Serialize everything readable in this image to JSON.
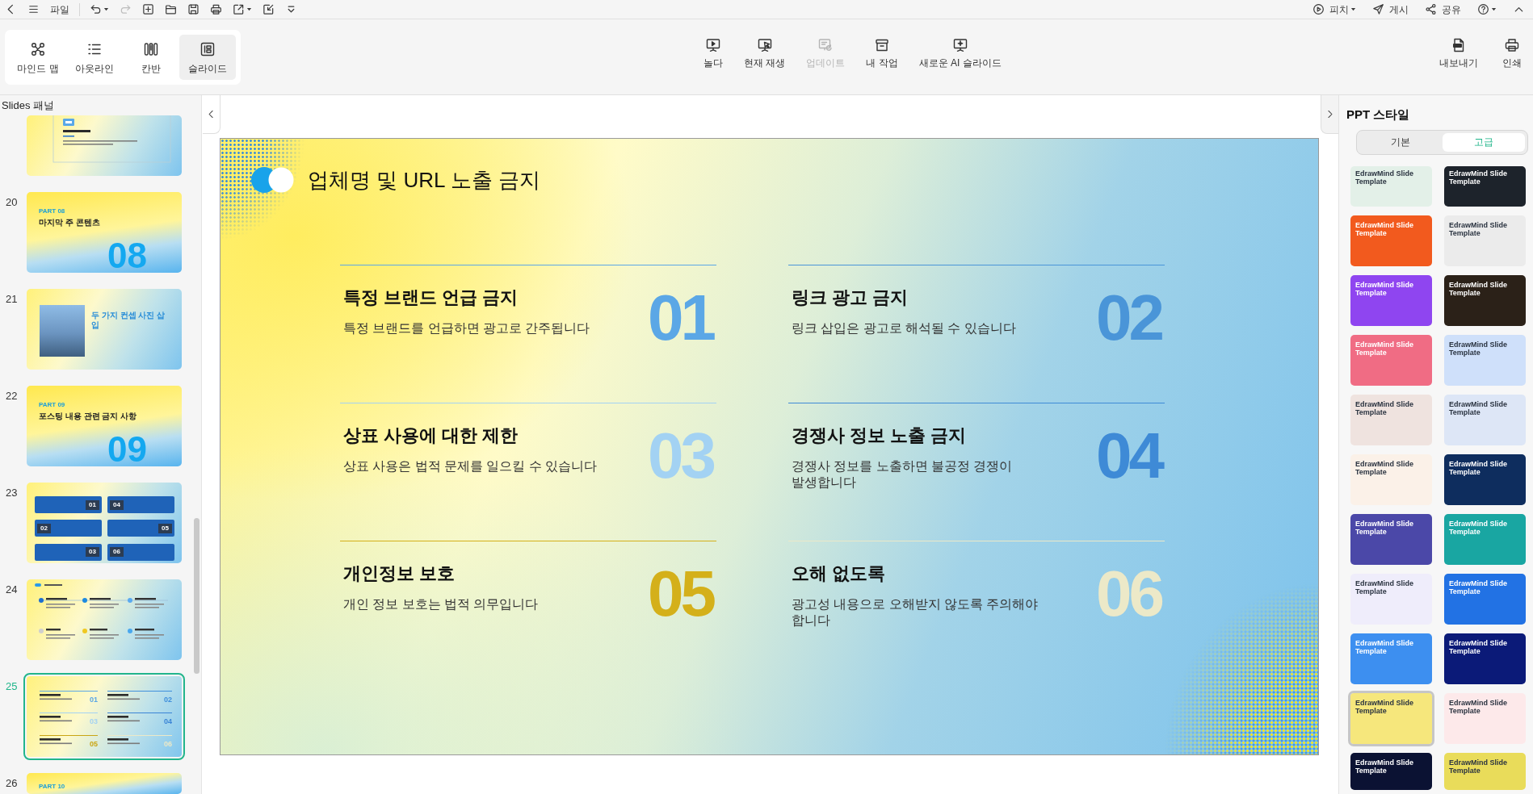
{
  "top_bar": {
    "file_menu": "파일",
    "undo": {
      "disabled": false
    },
    "redo": {
      "disabled": true
    },
    "actions": [
      {
        "label": "피치",
        "dropdown": true
      },
      {
        "label": "게시",
        "dropdown": false
      },
      {
        "label": "공유",
        "dropdown": false
      }
    ]
  },
  "ribbon": {
    "views": [
      {
        "label": "마인드 맵",
        "selected": false
      },
      {
        "label": "아웃라인",
        "selected": false
      },
      {
        "label": "칸반",
        "selected": false
      },
      {
        "label": "슬라이드",
        "selected": true
      }
    ],
    "actions": [
      {
        "label": "놀다",
        "disabled": false
      },
      {
        "label": "현재 재생",
        "disabled": false
      },
      {
        "label": "업데이트",
        "disabled": true
      },
      {
        "label": "내 작업",
        "disabled": false
      },
      {
        "label": "새로운 AI 슬라이드",
        "disabled": false
      }
    ],
    "outputs": [
      "내보내기",
      "인쇄"
    ]
  },
  "slides_panel": {
    "title": "Slides 패널",
    "slides": [
      {
        "kind": "text",
        "selected": false
      },
      {
        "number": "20",
        "kind": "section",
        "part": "PART 08",
        "title": "마지막 주 콘텐츠",
        "big_number": "08",
        "selected": false
      },
      {
        "number": "21",
        "kind": "photo",
        "title": "두 가지 컨셉 사진 삽입",
        "selected": false
      },
      {
        "number": "22",
        "kind": "section",
        "part": "PART 09",
        "title": "포스팅 내용 관련 금지 사항",
        "big_number": "09",
        "selected": false
      },
      {
        "number": "23",
        "kind": "grid",
        "numbers": [
          "01",
          "04",
          "02",
          "05",
          "03",
          "06"
        ],
        "selected": false
      },
      {
        "number": "24",
        "kind": "timeline",
        "selected": false
      },
      {
        "number": "25",
        "kind": "list",
        "numbers": [
          {
            "text": "01",
            "color": "#5ba7e6"
          },
          {
            "text": "02",
            "color": "#3f8fdc"
          },
          {
            "text": "03",
            "color": "#a3d2f3"
          },
          {
            "text": "04",
            "color": "#3a84d6"
          },
          {
            "text": "05",
            "color": "#c9a514"
          },
          {
            "text": "06",
            "color": "#ece9c8"
          }
        ],
        "selected": true
      },
      {
        "number": "26",
        "kind": "section",
        "part": "PART 10",
        "selected": false
      }
    ]
  },
  "slide": {
    "title": "업체명 및 URL 노출 금지",
    "items": [
      {
        "title": "특정 브랜드 언급 금지",
        "description": "특정 브랜드를 언급하면 광고로 간주됩니다",
        "number": "01",
        "color": "#5ba7e6"
      },
      {
        "title": "링크 광고 금지",
        "description": "링크 삽입은 광고로 해석될 수 있습니다",
        "number": "02",
        "color": "#4a95d8"
      },
      {
        "title": "상표 사용에 대한 제한",
        "description": "상표 사용은 법적 문제를 일으킬 수 있습니다",
        "number": "03",
        "color": "#a3d2f3"
      },
      {
        "title": "경쟁사 정보 노출 금지",
        "description": "경쟁사 정보를 노출하면 불공정 경쟁이 발생합니다",
        "number": "04",
        "color": "#3e8ad6"
      },
      {
        "title": "개인정보 보호",
        "description": "개인 정보 보호는 법적 의무입니다",
        "number": "05",
        "color": "#d4b01a"
      },
      {
        "title": "오해 없도록",
        "description": "광고성 내용으로 오해받지 않도록 주의해야 합니다",
        "number": "06",
        "color": "#ece9c8"
      }
    ]
  },
  "style_panel": {
    "title": "PPT 스타일",
    "tabs": [
      {
        "label": "기본",
        "selected": false
      },
      {
        "label": "고급",
        "selected": true
      }
    ],
    "templates": [
      {
        "title": "EdrawMind Slide Template",
        "color": "#e3f0e8",
        "selected": false
      },
      {
        "title": "EdrawMind Slide Template",
        "color": "#1d232b",
        "selected": false
      },
      {
        "title": "EdrawMind Slide Template",
        "color": "#f25a1e",
        "selected": false
      },
      {
        "title": "EdrawMind Slide Template",
        "color": "#ebebeb",
        "selected": false
      },
      {
        "title": "EdrawMind Slide Template",
        "color": "#8f45f0",
        "selected": false
      },
      {
        "title": "EdrawMind Slide Template",
        "color": "#2b2118",
        "selected": false
      },
      {
        "title": "EdrawMind Slide Template",
        "color": "#f06c84",
        "selected": false
      },
      {
        "title": "EdrawMind Slide Template",
        "color": "#cfe0fa",
        "selected": false
      },
      {
        "title": "EdrawMind Slide Template",
        "color": "#efe3df",
        "selected": false
      },
      {
        "title": "EdrawMind Slide Template",
        "color": "#dde6f6",
        "selected": false
      },
      {
        "title": "EdrawMind Slide Template",
        "color": "#fbf1e8",
        "selected": false
      },
      {
        "title": "EdrawMind Slide Template",
        "color": "#0e2d5e",
        "selected": false
      },
      {
        "title": "EdrawMind Slide Template",
        "color": "#4b48a8",
        "selected": false
      },
      {
        "title": "EdrawMind Slide Template",
        "color": "#19a6a2",
        "selected": false
      },
      {
        "title": "EdrawMind Slide Template",
        "color": "#efedfb",
        "selected": false
      },
      {
        "title": "EdrawMind Slide Template",
        "color": "#2272e4",
        "selected": false
      },
      {
        "title": "EdrawMind Slide Template",
        "color": "#3d8ff0",
        "selected": false
      },
      {
        "title": "EdrawMind Slide Template",
        "color": "#0b1a78",
        "selected": false
      },
      {
        "title": "EdrawMind Slide Template",
        "color": "#f6e77c",
        "selected": true
      },
      {
        "title": "EdrawMind Slide Template",
        "color": "#fde9ea",
        "selected": false
      },
      {
        "title": "EdrawMind Slide Template",
        "color": "#0b1233",
        "selected": false
      },
      {
        "title": "EdrawMind Slide Template",
        "color": "#e9dc5a",
        "selected": false
      }
    ]
  }
}
